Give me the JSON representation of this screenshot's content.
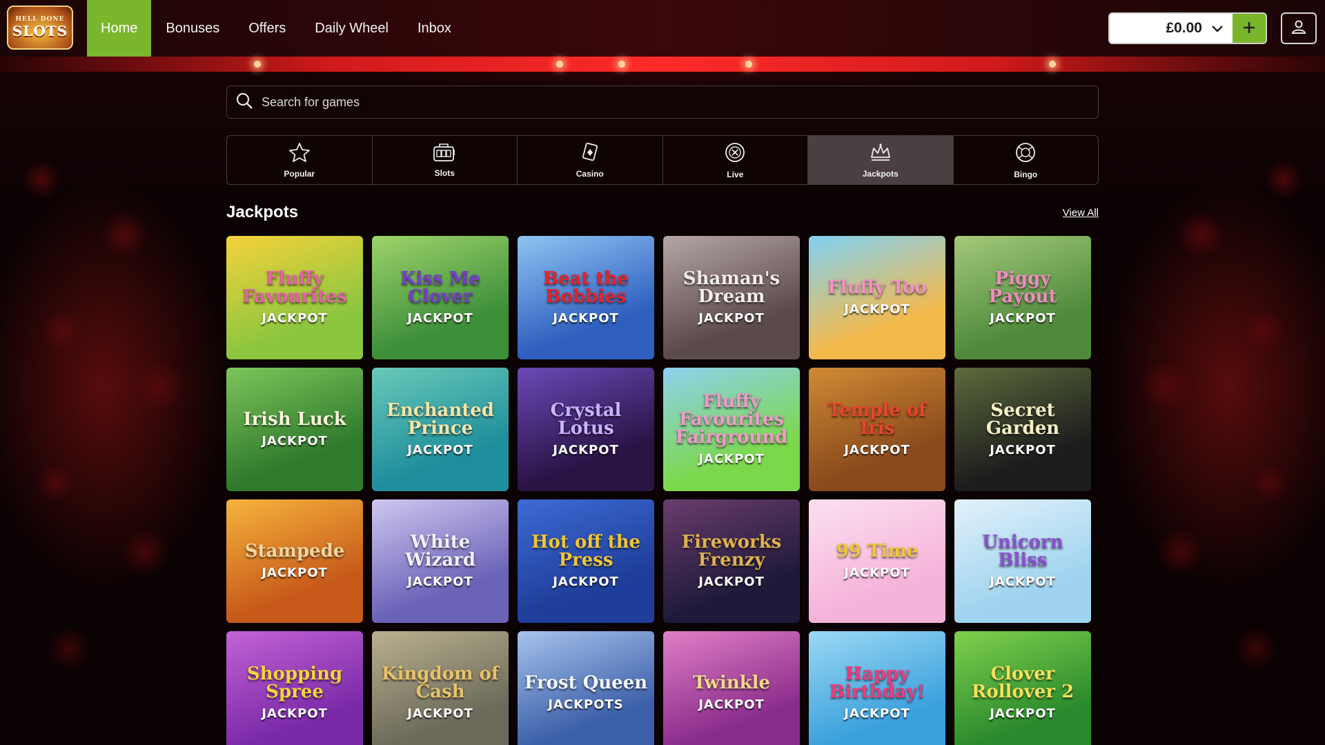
{
  "brand": {
    "logo_line1": "HELL DONE",
    "logo_line2": "SLOTS"
  },
  "nav": {
    "items": [
      {
        "label": "Home",
        "active": true
      },
      {
        "label": "Bonuses",
        "active": false
      },
      {
        "label": "Offers",
        "active": false
      },
      {
        "label": "Daily Wheel",
        "active": false
      },
      {
        "label": "Inbox",
        "active": false
      }
    ]
  },
  "wallet": {
    "balance": "£0.00",
    "deposit_icon": "plus-icon",
    "dropdown_icon": "chevron-down-icon"
  },
  "account": {
    "icon": "user-icon"
  },
  "search": {
    "placeholder": "Search for games",
    "icon": "search-icon"
  },
  "categories": [
    {
      "label": "Popular",
      "icon": "star-icon",
      "active": false
    },
    {
      "label": "Slots",
      "icon": "slot-machine-icon",
      "active": false
    },
    {
      "label": "Casino",
      "icon": "cards-icon",
      "active": false
    },
    {
      "label": "Live",
      "icon": "chip-icon",
      "active": false
    },
    {
      "label": "Jackpots",
      "icon": "crown-icon",
      "active": true
    },
    {
      "label": "Bingo",
      "icon": "bingo-ball-icon",
      "active": false
    }
  ],
  "section": {
    "title": "Jackpots",
    "view_all": "View All"
  },
  "colors": {
    "accent_green": "#79b62b",
    "stage_red": "#d11a1a"
  },
  "games": [
    {
      "title": "Fluffy Favourites",
      "tag": "JACKPOT",
      "bg": "#8cc63f",
      "bg2": "#f6d23a",
      "title_color": "#e85fb0"
    },
    {
      "title": "Kiss Me Clover",
      "tag": "JACKPOT",
      "bg": "#3d8f3a",
      "bg2": "#9ed36a",
      "title_color": "#7a3ad1"
    },
    {
      "title": "Beat the Bobbies",
      "tag": "JACKPOT",
      "bg": "#2e5fbf",
      "bg2": "#8fc4f2",
      "title_color": "#e5232b"
    },
    {
      "title": "Shaman's Dream",
      "tag": "JACKPOT",
      "bg": "#5b4a4c",
      "bg2": "#b5a6a6",
      "title_color": "#f2ede5"
    },
    {
      "title": "Fluffy Too",
      "tag": "JACKPOT",
      "bg": "#f5b94a",
      "bg2": "#7fd1f2",
      "title_color": "#f392c4"
    },
    {
      "title": "Piggy Payout",
      "tag": "JACKPOT",
      "bg": "#4f8a3b",
      "bg2": "#a3c97a",
      "title_color": "#f08cc1"
    },
    {
      "title": "Irish Luck",
      "tag": "JACKPOT",
      "bg": "#2f7a2c",
      "bg2": "#7cc55a",
      "title_color": "#f7f3d9"
    },
    {
      "title": "Enchanted Prince",
      "tag": "JACKPOT",
      "bg": "#1f8e9c",
      "bg2": "#69c9b8",
      "title_color": "#f5e6a8"
    },
    {
      "title": "Crystal Lotus",
      "tag": "JACKPOT",
      "bg": "#2a1446",
      "bg2": "#6a4ab8",
      "title_color": "#c9b5ff"
    },
    {
      "title": "Fluffy Favourites Fairground",
      "tag": "JACKPOT",
      "bg": "#7cd84b",
      "bg2": "#8fd0f0",
      "title_color": "#f19acb"
    },
    {
      "title": "Temple of Iris",
      "tag": "JACKPOT",
      "bg": "#8a4a1c",
      "bg2": "#d08a34",
      "title_color": "#e94430"
    },
    {
      "title": "Secret Garden",
      "tag": "JACKPOT",
      "bg": "#1d1d1d",
      "bg2": "#5d6b3c",
      "title_color": "#f7f0c8"
    },
    {
      "title": "Stampede",
      "tag": "JACKPOT",
      "bg": "#c75a1a",
      "bg2": "#f6b33c",
      "title_color": "#f2d7a4"
    },
    {
      "title": "White Wizard",
      "tag": "JACKPOT",
      "bg": "#6b63b8",
      "bg2": "#cfc7ef",
      "title_color": "#f3f0ff"
    },
    {
      "title": "Hot off the Press",
      "tag": "JACKPOT",
      "bg": "#1f3d9a",
      "bg2": "#3d6bd4",
      "title_color": "#f2c633"
    },
    {
      "title": "Fireworks Frenzy",
      "tag": "JACKPOT",
      "bg": "#1f1a3a",
      "bg2": "#6a3d6e",
      "title_color": "#e0b14c"
    },
    {
      "title": "99 Time",
      "tag": "JACKPOT",
      "bg": "#f6b3da",
      "bg2": "#fbe0ef",
      "title_color": "#f2c633"
    },
    {
      "title": "Unicorn Bliss",
      "tag": "JACKPOT",
      "bg": "#9fd3ef",
      "bg2": "#e2f1fb",
      "title_color": "#8a4fd1"
    },
    {
      "title": "Shopping Spree",
      "tag": "JACKPOT",
      "bg": "#7a2aa8",
      "bg2": "#c462d6",
      "title_color": "#f5d43a"
    },
    {
      "title": "Kingdom of Cash",
      "tag": "JACKPOT",
      "bg": "#6c6a5a",
      "bg2": "#b9b08e",
      "title_color": "#e8c36a"
    },
    {
      "title": "Frost Queen",
      "tag": "JACKPOTS",
      "bg": "#3b5fa8",
      "bg2": "#a6c2ec",
      "title_color": "#f3f8ff"
    },
    {
      "title": "Twinkle",
      "tag": "JACKPOT",
      "bg": "#8a2c8c",
      "bg2": "#e07fc5",
      "title_color": "#f4d98a"
    },
    {
      "title": "Happy Birthday!",
      "tag": "JACKPOT",
      "bg": "#3aa0dc",
      "bg2": "#9bd8f4",
      "title_color": "#f03a7a"
    },
    {
      "title": "Clover Rollover 2",
      "tag": "JACKPOT",
      "bg": "#2b8a2d",
      "bg2": "#7fd04c",
      "title_color": "#f3e25a"
    }
  ]
}
